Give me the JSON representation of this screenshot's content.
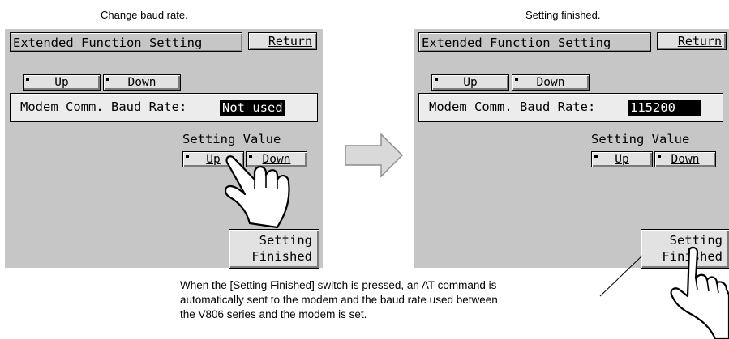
{
  "left_caption": "Change baud rate.",
  "right_caption": "Setting finished.",
  "left_screen": {
    "title": "Extended Function Setting",
    "return_label": "Return",
    "up_label": "Up",
    "down_label": "Down",
    "baud_label": "Modem Comm. Baud Rate:",
    "baud_value": "Not used",
    "setting_value_label": "Setting Value",
    "sv_up_label": "Up",
    "sv_down_label": "Down",
    "finish_line1": "Setting",
    "finish_line2": "Finished"
  },
  "right_screen": {
    "title": "Extended Function Setting",
    "return_label": "Return",
    "up_label": "Up",
    "down_label": "Down",
    "baud_label": "Modem Comm. Baud Rate:",
    "baud_value": "115200",
    "setting_value_label": "Setting Value",
    "sv_up_label": "Up",
    "sv_down_label": "Down",
    "finish_line1": "Setting",
    "finish_line2": "Finished"
  },
  "note": {
    "line1": "When the [Setting Finished] switch is pressed, an AT command is",
    "line2": "automatically sent to the modem and the baud rate used between",
    "line3": "the V806 series and the modem is set."
  },
  "icons": {
    "hand": "pointing-hand-icon",
    "arrow": "right-arrow-icon"
  },
  "colors": {
    "screen_bg": "#c6c6c6",
    "button_bg": "#e2e2e2",
    "value_bg": "#000000",
    "value_text": "#ffffff"
  }
}
